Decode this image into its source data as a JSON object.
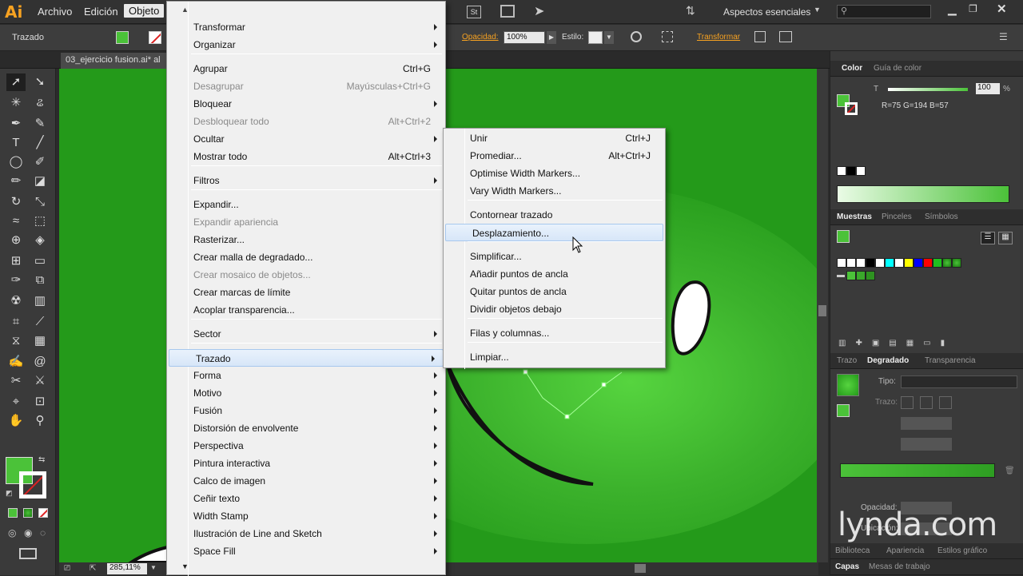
{
  "app": {
    "logo": "Ai"
  },
  "menubar": {
    "items": [
      "Archivo",
      "Edición",
      "Objeto"
    ]
  },
  "workspace": {
    "label": "Aspectos esenciales"
  },
  "control": {
    "mode_label": "Trazado",
    "opacity_label": "Opacidad:",
    "opacity_value": "100%",
    "style_label": "Estilo:",
    "transform_label": "Transformar",
    "st_label": "St"
  },
  "document": {
    "tab": "03_ejercicio fusion.ai* al",
    "zoom": "285,11%"
  },
  "object_menu": {
    "items": [
      {
        "label": "Transformar",
        "sub": true
      },
      {
        "label": "Organizar",
        "sub": true
      },
      {
        "label": "Agrupar",
        "key": "Ctrl+G"
      },
      {
        "label": "Desagrupar",
        "key": "Mayúsculas+Ctrl+G",
        "disabled": true
      },
      {
        "label": "Bloquear",
        "sub": true
      },
      {
        "label": "Desbloquear todo",
        "key": "Alt+Ctrl+2",
        "disabled": true
      },
      {
        "label": "Ocultar",
        "sub": true
      },
      {
        "label": "Mostrar todo",
        "key": "Alt+Ctrl+3"
      },
      {
        "label": "Filtros",
        "sub": true
      },
      {
        "label": "Expandir..."
      },
      {
        "label": "Expandir apariencia",
        "disabled": true
      },
      {
        "label": "Rasterizar..."
      },
      {
        "label": "Crear malla de degradado..."
      },
      {
        "label": "Crear mosaico de objetos...",
        "disabled": true
      },
      {
        "label": "Crear marcas de límite"
      },
      {
        "label": "Acoplar transparencia..."
      },
      {
        "label": "Sector",
        "sub": true
      },
      {
        "label": "Trazado",
        "sub": true,
        "highlighted": true
      },
      {
        "label": "Forma",
        "sub": true
      },
      {
        "label": "Motivo",
        "sub": true
      },
      {
        "label": "Fusión",
        "sub": true
      },
      {
        "label": "Distorsión de envolvente",
        "sub": true
      },
      {
        "label": "Perspectiva",
        "sub": true
      },
      {
        "label": "Pintura interactiva",
        "sub": true
      },
      {
        "label": "Calco de imagen",
        "sub": true
      },
      {
        "label": "Ceñir texto",
        "sub": true
      },
      {
        "label": "Width Stamp",
        "sub": true
      },
      {
        "label": "Ilustración de Line and Sketch",
        "sub": true
      },
      {
        "label": "Space Fill",
        "sub": true
      }
    ]
  },
  "path_submenu": {
    "items": [
      {
        "label": "Unir",
        "key": "Ctrl+J"
      },
      {
        "label": "Promediar...",
        "key": "Alt+Ctrl+J"
      },
      {
        "label": "Optimise Width Markers..."
      },
      {
        "label": "Vary Width Markers..."
      },
      {
        "label": "Contornear trazado"
      },
      {
        "label": "Desplazamiento...",
        "highlighted": true
      },
      {
        "label": "Simplificar..."
      },
      {
        "label": "Añadir puntos de ancla"
      },
      {
        "label": "Quitar puntos de ancla"
      },
      {
        "label": "Dividir objetos debajo"
      },
      {
        "label": "Filas y columnas..."
      },
      {
        "label": "Limpiar..."
      }
    ]
  },
  "panels": {
    "color": {
      "tab1": "Color",
      "tab2": "Guía de color",
      "t_label": "T",
      "t_value": "100",
      "pct": "%",
      "rgb": "R=75 G=194 B=57"
    },
    "swatches": {
      "tab1": "Muestras",
      "tab2": "Pinceles",
      "tab3": "Símbolos"
    },
    "gradient": {
      "tab1": "Trazo",
      "tab2": "Degradado",
      "tab3": "Transparencia",
      "type_label": "Tipo:",
      "stroke_label": "Trazo:",
      "opacity_label": "Opacidad:",
      "location_label": "Ubicación:"
    },
    "bottom": {
      "tab1": "Biblioteca",
      "tab2": "Apariencia",
      "tab3": "Estilos gráfico",
      "tab4": "Capas",
      "tab5": "Mesas de trabajo"
    }
  },
  "colors": {
    "canvas": "#249a1a",
    "fill": "#4bc239",
    "accent": "#f7a221"
  },
  "watermark": "lynda.com"
}
